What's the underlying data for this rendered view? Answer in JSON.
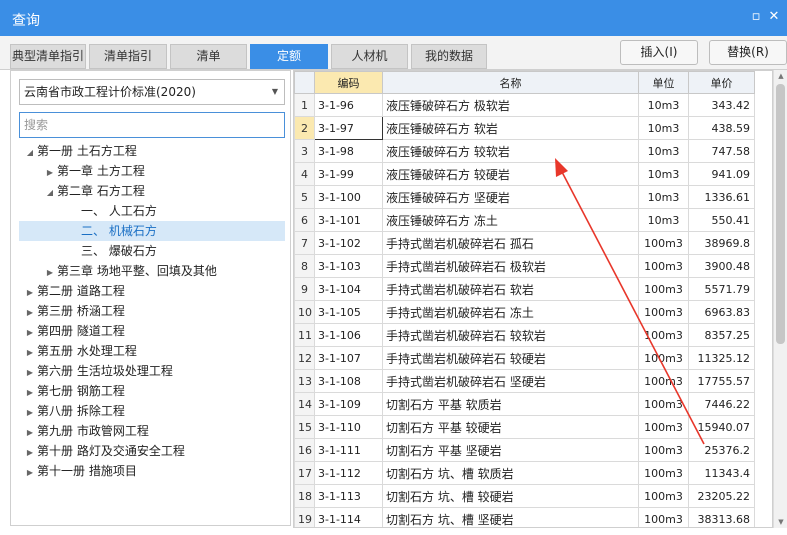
{
  "window": {
    "title": "查询"
  },
  "tabs": [
    {
      "label": "典型清单指引"
    },
    {
      "label": "清单指引"
    },
    {
      "label": "清单"
    },
    {
      "label": "定额"
    },
    {
      "label": "人材机"
    },
    {
      "label": "我的数据"
    }
  ],
  "actions": {
    "insert": "插入(I)",
    "replace": "替换(R)"
  },
  "left": {
    "standard": "云南省市政工程计价标准(2020)",
    "search_placeholder": "搜索",
    "tree": [
      {
        "label": "第一册 土石方工程"
      },
      {
        "label": "第一章 土方工程"
      },
      {
        "label": "第二章 石方工程"
      },
      {
        "label": "一、 人工石方"
      },
      {
        "label": "二、 机械石方"
      },
      {
        "label": "三、 爆破石方"
      },
      {
        "label": "第三章 场地平整、回填及其他"
      },
      {
        "label": "第二册 道路工程"
      },
      {
        "label": "第三册 桥涵工程"
      },
      {
        "label": "第四册 隧道工程"
      },
      {
        "label": "第五册 水处理工程"
      },
      {
        "label": "第六册 生活垃圾处理工程"
      },
      {
        "label": "第七册 钢筋工程"
      },
      {
        "label": "第八册 拆除工程"
      },
      {
        "label": "第九册 市政管网工程"
      },
      {
        "label": "第十册 路灯及交通安全工程"
      },
      {
        "label": "第十一册 措施项目"
      }
    ]
  },
  "grid": {
    "headers": {
      "code": "编码",
      "name": "名称",
      "unit": "单位",
      "price": "单价"
    },
    "rows": [
      {
        "no": "1",
        "code": "3-1-96",
        "name": "液压锤破碎石方 极软岩",
        "unit": "10m3",
        "price": "343.42"
      },
      {
        "no": "2",
        "code": "3-1-97",
        "name": "液压锤破碎石方 软岩",
        "unit": "10m3",
        "price": "438.59"
      },
      {
        "no": "3",
        "code": "3-1-98",
        "name": "液压锤破碎石方 较软岩",
        "unit": "10m3",
        "price": "747.58"
      },
      {
        "no": "4",
        "code": "3-1-99",
        "name": "液压锤破碎石方 较硬岩",
        "unit": "10m3",
        "price": "941.09"
      },
      {
        "no": "5",
        "code": "3-1-100",
        "name": "液压锤破碎石方 坚硬岩",
        "unit": "10m3",
        "price": "1336.61"
      },
      {
        "no": "6",
        "code": "3-1-101",
        "name": "液压锤破碎石方 冻土",
        "unit": "10m3",
        "price": "550.41"
      },
      {
        "no": "7",
        "code": "3-1-102",
        "name": "手持式凿岩机破碎岩石 孤石",
        "unit": "100m3",
        "price": "38969.8"
      },
      {
        "no": "8",
        "code": "3-1-103",
        "name": "手持式凿岩机破碎岩石 极软岩",
        "unit": "100m3",
        "price": "3900.48"
      },
      {
        "no": "9",
        "code": "3-1-104",
        "name": "手持式凿岩机破碎岩石 软岩",
        "unit": "100m3",
        "price": "5571.79"
      },
      {
        "no": "10",
        "code": "3-1-105",
        "name": "手持式凿岩机破碎岩石 冻土",
        "unit": "100m3",
        "price": "6963.83"
      },
      {
        "no": "11",
        "code": "3-1-106",
        "name": "手持式凿岩机破碎岩石 较软岩",
        "unit": "100m3",
        "price": "8357.25"
      },
      {
        "no": "12",
        "code": "3-1-107",
        "name": "手持式凿岩机破碎岩石 较硬岩",
        "unit": "100m3",
        "price": "11325.12"
      },
      {
        "no": "13",
        "code": "3-1-108",
        "name": "手持式凿岩机破碎岩石 坚硬岩",
        "unit": "100m3",
        "price": "17755.57"
      },
      {
        "no": "14",
        "code": "3-1-109",
        "name": "切割石方 平基 软质岩",
        "unit": "100m3",
        "price": "7446.22"
      },
      {
        "no": "15",
        "code": "3-1-110",
        "name": "切割石方 平基 较硬岩",
        "unit": "100m3",
        "price": "15940.07"
      },
      {
        "no": "16",
        "code": "3-1-111",
        "name": "切割石方 平基 坚硬岩",
        "unit": "100m3",
        "price": "25376.2"
      },
      {
        "no": "17",
        "code": "3-1-112",
        "name": "切割石方 坑、槽 软质岩",
        "unit": "100m3",
        "price": "11343.4"
      },
      {
        "no": "18",
        "code": "3-1-113",
        "name": "切割石方 坑、槽 较硬岩",
        "unit": "100m3",
        "price": "23205.22"
      },
      {
        "no": "19",
        "code": "3-1-114",
        "name": "切割石方 坑、槽 坚硬岩",
        "unit": "100m3",
        "price": "38313.68"
      }
    ]
  },
  "colors": {
    "accent": "#3a8ee6",
    "annotation": "#e8372b",
    "header_highlight": "#fbe9b0"
  },
  "icons": {
    "maximize": "maximize-icon",
    "close": "close-icon",
    "dropdown": "chevron-down-icon"
  }
}
